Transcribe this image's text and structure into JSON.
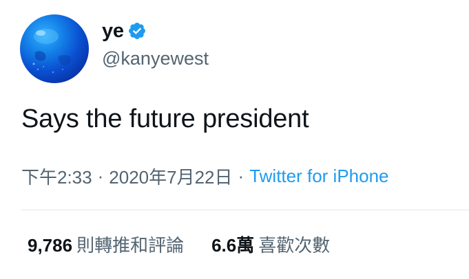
{
  "user": {
    "display_name": "ye",
    "handle": "@kanyewest",
    "verified": true,
    "avatar_icon": "blue-globe-avatar"
  },
  "tweet": {
    "text": "Says the future president",
    "time": "下午2:33",
    "separator": "·",
    "date": "2020年7月22日",
    "source": "Twitter for iPhone"
  },
  "stats": {
    "retweets_count": "9,786",
    "retweets_label": "則轉推和評論",
    "likes_count": "6.6萬",
    "likes_label": "喜歡次數"
  },
  "colors": {
    "link": "#1d9bf0",
    "verified_badge": "#1d9bf0",
    "secondary_text": "#536471",
    "primary_text": "#0f1419"
  }
}
